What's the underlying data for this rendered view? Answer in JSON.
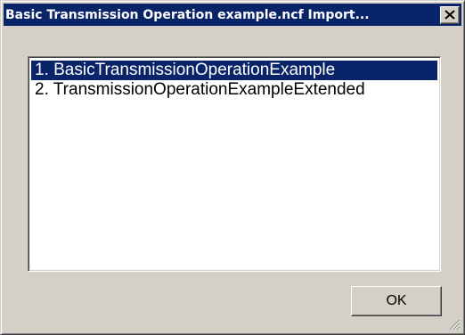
{
  "window": {
    "title": "Basic Transmission Operation example.ncf Import...",
    "close_icon": "close-x-icon"
  },
  "list": {
    "items": [
      {
        "label": "1. BasicTransmissionOperationExample",
        "selected": true
      },
      {
        "label": "2. TransmissionOperationExampleExtended",
        "selected": false
      }
    ]
  },
  "buttons": {
    "ok_label": "OK"
  },
  "colors": {
    "titlebar": "#0a246a",
    "selection": "#0a246a",
    "face": "#d4d0c8"
  }
}
